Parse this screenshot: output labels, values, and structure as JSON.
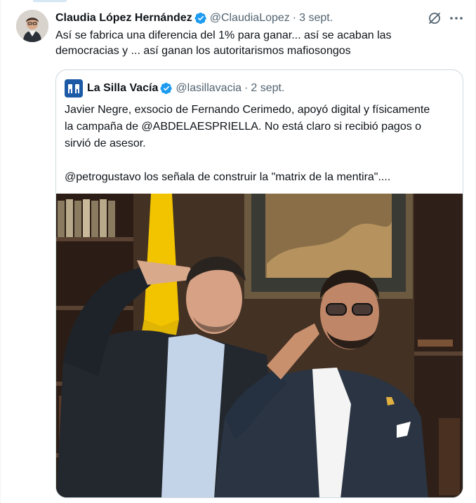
{
  "tweet": {
    "author_name": "Claudia López Hernández",
    "author_handle": "@ClaudiaLopez",
    "separator": "·",
    "date": "3 sept.",
    "text": "Así se fabrica una diferencia del 1% para ganar... así se acaban las democracias y ... así ganan los autoritarismos mafiosongos"
  },
  "quoted": {
    "author_name": "La Silla Vacía",
    "author_handle": "@lasillavacia",
    "separator": "·",
    "date": "2 sept.",
    "text_line1": "Javier Negre, exsocio de Fernando Cerimedo, apoyó digital y físicamente la campaña de @ABDELAESPRIELLA. No está claro si recibió pagos o sirvió de asesor.",
    "text_line2": "@petrogustavo los señala de construir la \"matrix de la mentira\"...."
  },
  "icons": {
    "verified": "verified-badge-icon",
    "grok": "grok-icon",
    "more": "more-icon"
  },
  "colors": {
    "verified_blue": "#1d9bf0",
    "text": "#0f1419",
    "secondary_text": "#536471",
    "border": "#cfd9de",
    "brand_blue": "#1d5aa6"
  }
}
